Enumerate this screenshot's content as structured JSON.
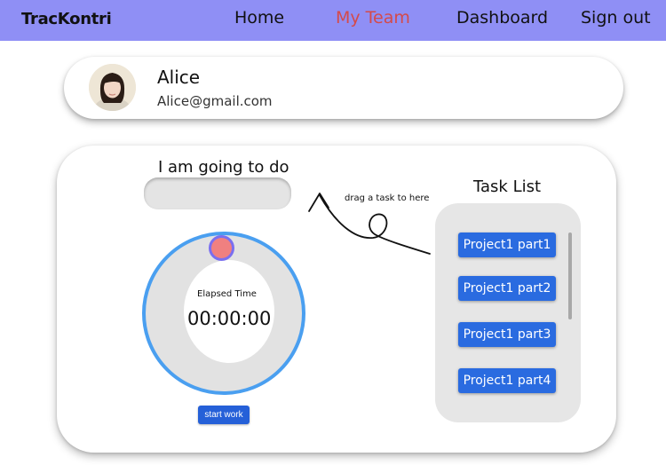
{
  "navbar": {
    "brand": "TracKontri",
    "links": [
      {
        "label": "Home",
        "active": false
      },
      {
        "label": "My Team",
        "active": true
      },
      {
        "label": "Dashboard",
        "active": false
      },
      {
        "label": "Sign out",
        "active": false
      }
    ]
  },
  "profile": {
    "name": "Alice",
    "email": "Alice@gmail.com"
  },
  "work": {
    "going_label": "I am going to do",
    "drop_value": "",
    "hint": "drag a task to here"
  },
  "timer": {
    "elapsed_label": "Elapsed Time",
    "elapsed_time": "00:00:00",
    "start_label": "start work"
  },
  "task_list": {
    "title": "Task List",
    "items": [
      {
        "label": "Project1 part1"
      },
      {
        "label": "Project1 part2"
      },
      {
        "label": "Project1 part3"
      },
      {
        "label": "Project1 part4"
      }
    ]
  },
  "colors": {
    "navbar": "#8f8ff5",
    "active_link": "#d44a4a",
    "ring": "#4a9ff0",
    "knob": "#f08080",
    "task_button": "#2a6be0"
  }
}
